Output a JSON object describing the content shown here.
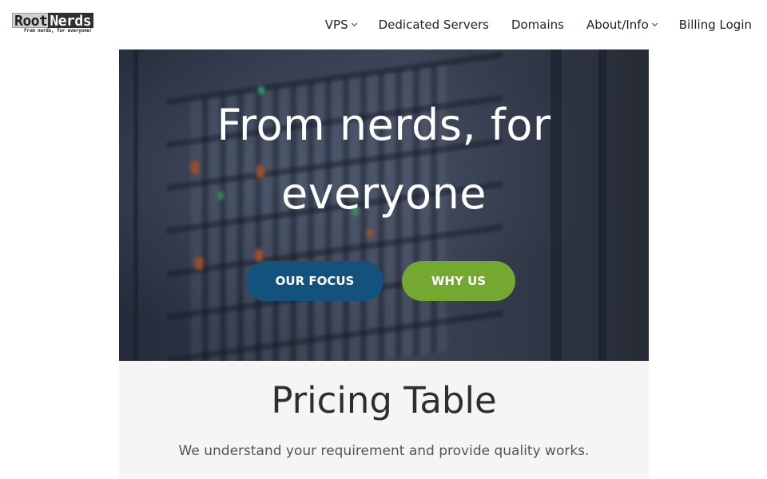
{
  "header": {
    "logo": {
      "part1": "Root",
      "part2": "Nerds",
      "tagline": "From nerds, for everyone!"
    },
    "nav": [
      {
        "label": "VPS",
        "has_dropdown": true
      },
      {
        "label": "Dedicated Servers",
        "has_dropdown": false
      },
      {
        "label": "Domains",
        "has_dropdown": false
      },
      {
        "label": "About/Info",
        "has_dropdown": true
      },
      {
        "label": "Billing Login",
        "has_dropdown": false
      }
    ]
  },
  "hero": {
    "title_line1": "From nerds, for",
    "title_line2": "everyone",
    "buttons": [
      {
        "label": "OUR FOCUS",
        "color": "#14527e"
      },
      {
        "label": "WHY US",
        "color": "#74a830"
      }
    ]
  },
  "pricing": {
    "title": "Pricing Table",
    "subtitle": "We understand your requirement and provide quality works."
  },
  "colors": {
    "header_bg": "#ffffff",
    "pricing_bg": "#f5f5f5",
    "text_dark": "#2e2e2e"
  }
}
